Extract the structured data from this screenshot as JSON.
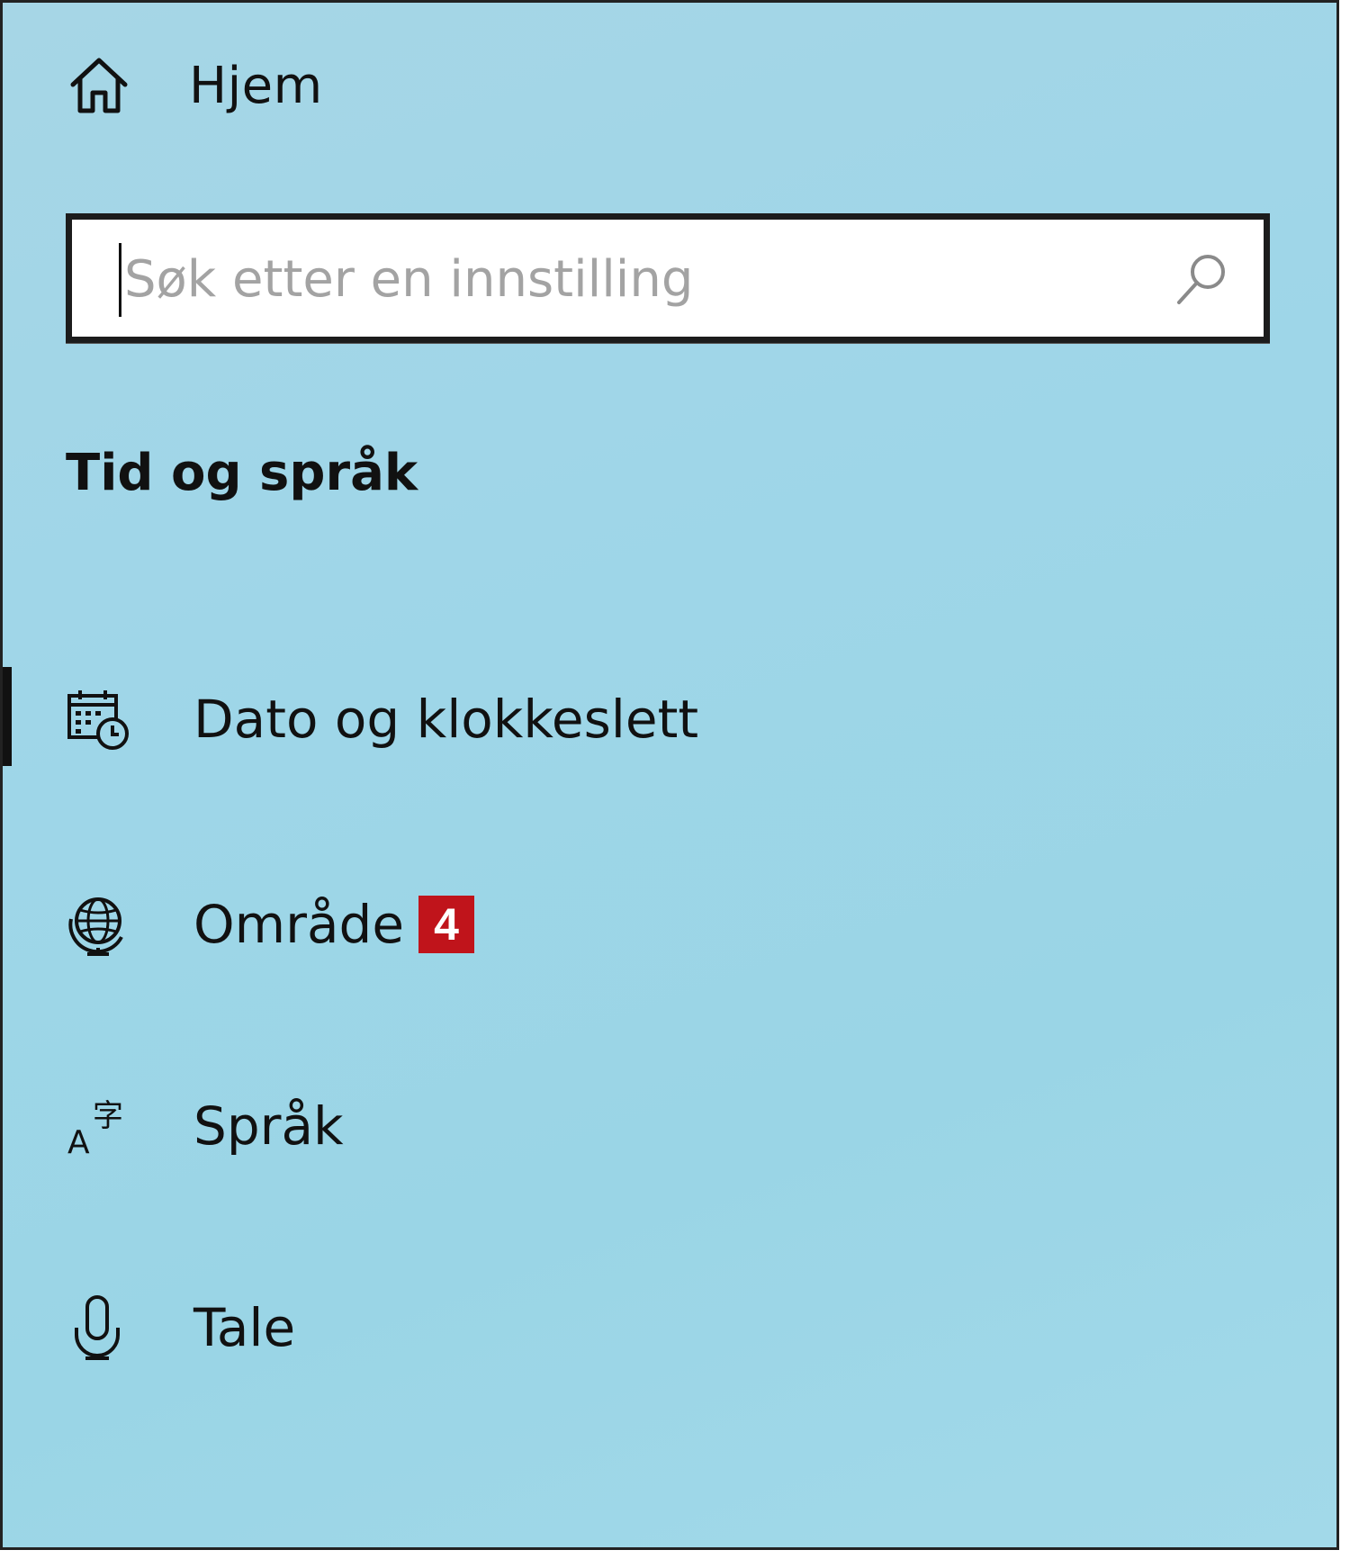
{
  "nav": {
    "home_label": "Hjem"
  },
  "search": {
    "placeholder": "Søk etter en innstilling",
    "value": ""
  },
  "section": {
    "title": "Tid og språk"
  },
  "items": [
    {
      "label": "Dato og klokkeslett",
      "icon": "calendar-clock-icon",
      "active": true
    },
    {
      "label": "Område",
      "icon": "globe-icon",
      "badge": "4"
    },
    {
      "label": "Språk",
      "icon": "language-icon"
    },
    {
      "label": "Tale",
      "icon": "microphone-icon"
    }
  ],
  "colors": {
    "panel_background": "#9fd6e8",
    "badge_background": "#c0141b",
    "text": "#111111",
    "placeholder": "#a3a3a3"
  }
}
